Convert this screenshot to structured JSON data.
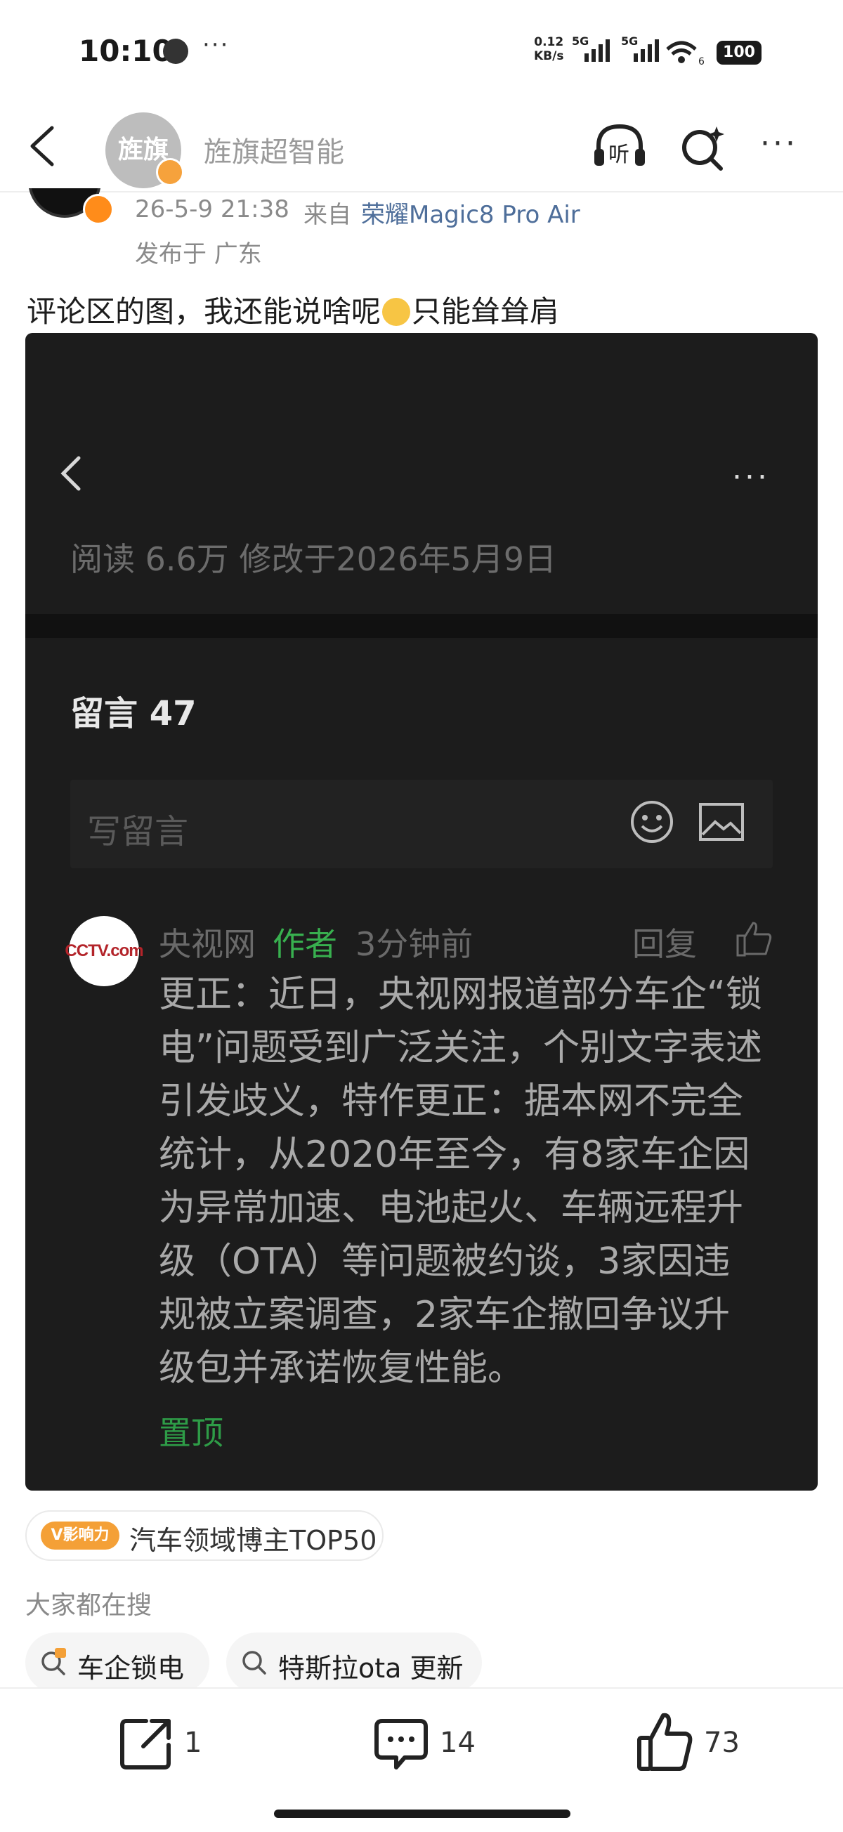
{
  "status_bar": {
    "time": "10:10",
    "more": "···",
    "net_speed_value": "0.12",
    "net_speed_unit": "KB/s",
    "sim1": "5G",
    "sim2": "5G",
    "wifi_badge": "6",
    "battery": "100"
  },
  "header": {
    "avatar_text": "旌旗",
    "account_name": "旌旗超智能"
  },
  "post": {
    "time": "26-5-9 21:38",
    "source_prefix": "来自",
    "device": "荣耀Magic8 Pro Air",
    "location": "发布于 广东",
    "text_before_emoji": "评论区的图，我还能说啥呢",
    "text_after_emoji": "只能耸耸肩"
  },
  "screenshot": {
    "more": "···",
    "stats": "阅读 6.6万   修改于2026年5月9日",
    "comments_title": "留言 47",
    "input_placeholder": "写留言",
    "comment": {
      "avatar_logo": "CCTV.com",
      "name": "央视网",
      "author_tag": "作者",
      "time": "3分钟前",
      "reply": "回复",
      "body": "更正：近日，央视网报道部分车企“锁电”问题受到广泛关注，个别文字表述引发歧义，特作更正：据本网不完全统计，从2020年至今，有8家车企因为异常加速、电池起火、车辆远程升级（OTA）等问题被约谈，3家因违规被立案调查，2家车企撤回争议升级包并承诺恢复性能。",
      "pinned": "置顶"
    }
  },
  "influence": {
    "badge": "V影响力",
    "text": "汽车领域博主TOP50"
  },
  "trending": {
    "label": "大家都在搜",
    "chips": [
      "车企锁电",
      "特斯拉ota 更新"
    ]
  },
  "actions": {
    "share_count": "1",
    "comment_count": "14",
    "like_count": "73"
  },
  "colors": {
    "link_blue": "#4e6e9a",
    "author_green": "#38b04f",
    "badge_orange": "#f4a037"
  }
}
